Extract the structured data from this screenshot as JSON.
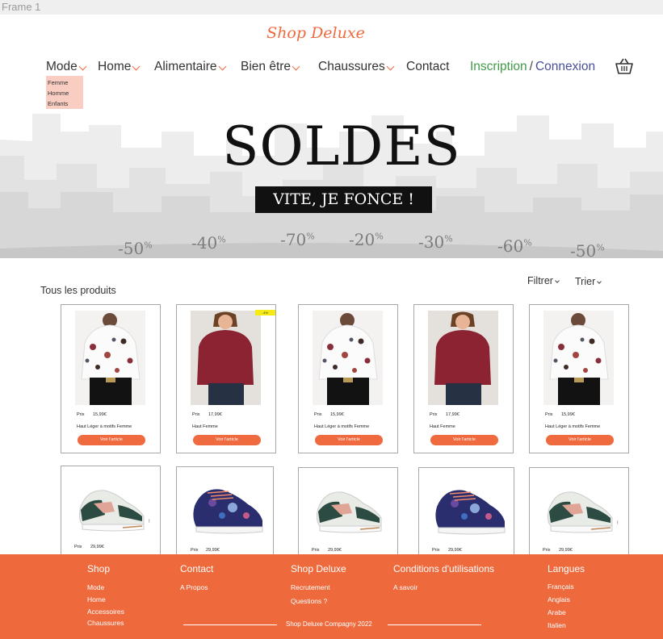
{
  "frame_label": "Frame 1",
  "logo": "Shop Deluxe",
  "nav": {
    "items": [
      {
        "label": "Mode",
        "chevron": true
      },
      {
        "label": "Home",
        "chevron": true
      },
      {
        "label": "Alimentaire",
        "chevron": true
      },
      {
        "label": "Bien être",
        "chevron": true
      },
      {
        "label": "Chaussures",
        "chevron": true
      },
      {
        "label": "Contact",
        "chevron": false
      }
    ],
    "inscription": "Inscription",
    "separator": "/",
    "connexion": "Connexion",
    "cart_icon": "basket-icon"
  },
  "submenu": [
    "Femme",
    "Homme",
    "Enfants"
  ],
  "hero": {
    "title": "SOLDES",
    "button": "VITE, JE FONCE !",
    "discounts": [
      "-50",
      "-40",
      "-70",
      "-20",
      "-30",
      "-60",
      "-50"
    ],
    "percent_sign": "%"
  },
  "products_section": {
    "title": "Tous les produits",
    "filter_label": "Filtrer",
    "sort_label": "Trier"
  },
  "product_row_1": [
    {
      "price_label": "Prix",
      "price": "15,99€",
      "name": "Haut Léger à motifs Femme",
      "button": "Voir l'article",
      "image": "floral-blouse"
    },
    {
      "price_label": "Prix",
      "price": "17,99€",
      "name": "Haut Femme",
      "button": "Voir l'article",
      "image": "red-blouse",
      "tag": "-4%"
    },
    {
      "price_label": "Prix",
      "price": "15,99€",
      "name": "Haut Léger à motifs Femme",
      "button": "Voir l'article",
      "image": "floral-blouse"
    },
    {
      "price_label": "Prix",
      "price": "17,99€",
      "name": "Haut Femme",
      "button": "Voir l'article",
      "image": "red-blouse"
    },
    {
      "price_label": "Prix",
      "price": "15,99€",
      "name": "Haut Léger à motifs Femme",
      "button": "Voir l'article",
      "image": "floral-blouse"
    }
  ],
  "product_row_2": [
    {
      "price_label": "Prix",
      "price": "29,99€",
      "image": "green-sneaker"
    },
    {
      "price_label": "Prix",
      "price": "29,99€",
      "image": "galaxy-sneaker"
    },
    {
      "price_label": "Prix",
      "price": "29,99€",
      "image": "green-sneaker"
    },
    {
      "price_label": "Prix",
      "price": "29,99€",
      "image": "galaxy-sneaker"
    },
    {
      "price_label": "Prix",
      "price": "29,99€",
      "image": "green-sneaker"
    }
  ],
  "footer": {
    "shop": {
      "title": "Shop",
      "links": [
        "Mode",
        "Home",
        "Accessoires",
        "Chaussures"
      ]
    },
    "contact": {
      "title": "Contact",
      "links": [
        "A Propos"
      ]
    },
    "shop_deluxe": {
      "title": "Shop Deluxe",
      "links": [
        "Recrutement",
        "Questions ?"
      ]
    },
    "conditions": {
      "title": "Conditions d'utilisations",
      "links": [
        "A savoir"
      ]
    },
    "langues": {
      "title": "Langues",
      "links": [
        "Français",
        "Anglais",
        "Arabe",
        "Italien"
      ]
    },
    "copyright": "Shop Deluxe Compagny 2022"
  },
  "colors": {
    "accent": "#ee6a3d",
    "inscription": "#3f9a47",
    "connexion": "#4a4e9a",
    "submenu_bg": "#f9cdc1"
  }
}
